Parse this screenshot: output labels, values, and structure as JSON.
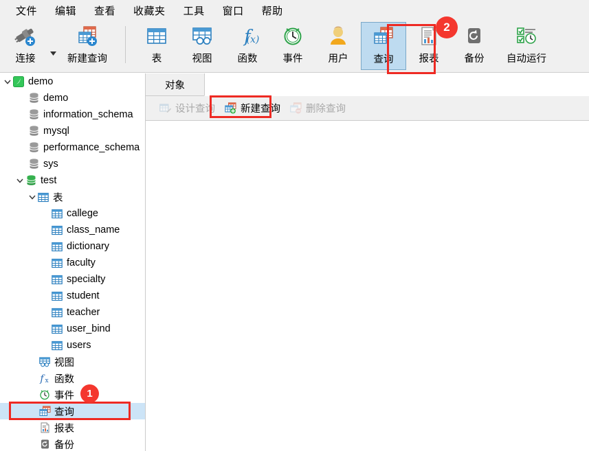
{
  "menubar": {
    "items": [
      {
        "label": "文件"
      },
      {
        "label": "编辑"
      },
      {
        "label": "查看"
      },
      {
        "label": "收藏夹"
      },
      {
        "label": "工具"
      },
      {
        "label": "窗口"
      },
      {
        "label": "帮助"
      }
    ]
  },
  "toolbar": {
    "items": [
      {
        "label": "连接",
        "icon": "plug-icon"
      },
      {
        "label": "新建查询",
        "icon": "new-query-icon"
      },
      {
        "label": "表",
        "icon": "table-icon"
      },
      {
        "label": "视图",
        "icon": "view-icon"
      },
      {
        "label": "函数",
        "icon": "function-icon"
      },
      {
        "label": "事件",
        "icon": "clock-icon"
      },
      {
        "label": "用户",
        "icon": "user-icon"
      },
      {
        "label": "查询",
        "icon": "query-icon"
      },
      {
        "label": "报表",
        "icon": "report-icon"
      },
      {
        "label": "备份",
        "icon": "backup-icon"
      },
      {
        "label": "自动运行",
        "icon": "automation-icon"
      }
    ]
  },
  "sidebar": {
    "tree": [
      {
        "label": "demo",
        "icon": "connection-icon",
        "indent": 0,
        "chevron": "expanded"
      },
      {
        "label": "demo",
        "icon": "database-icon",
        "indent": 1,
        "chevron": "none"
      },
      {
        "label": "information_schema",
        "icon": "database-icon",
        "indent": 1,
        "chevron": "none"
      },
      {
        "label": "mysql",
        "icon": "database-icon",
        "indent": 1,
        "chevron": "none"
      },
      {
        "label": "performance_schema",
        "icon": "database-icon",
        "indent": 1,
        "chevron": "none"
      },
      {
        "label": "sys",
        "icon": "database-icon",
        "indent": 1,
        "chevron": "none"
      },
      {
        "label": "test",
        "icon": "database-open-icon",
        "indent": 1,
        "chevron": "expanded"
      },
      {
        "label": "表",
        "icon": "table-folder-icon",
        "indent": 2,
        "chevron": "expanded"
      },
      {
        "label": "callege",
        "icon": "table-icon",
        "indent": 3,
        "chevron": "none"
      },
      {
        "label": "class_name",
        "icon": "table-icon",
        "indent": 3,
        "chevron": "none"
      },
      {
        "label": "dictionary",
        "icon": "table-icon",
        "indent": 3,
        "chevron": "none"
      },
      {
        "label": "faculty",
        "icon": "table-icon",
        "indent": 3,
        "chevron": "none"
      },
      {
        "label": "specialty",
        "icon": "table-icon",
        "indent": 3,
        "chevron": "none"
      },
      {
        "label": "student",
        "icon": "table-icon",
        "indent": 3,
        "chevron": "none"
      },
      {
        "label": "teacher",
        "icon": "table-icon",
        "indent": 3,
        "chevron": "none"
      },
      {
        "label": "user_bind",
        "icon": "table-icon",
        "indent": 3,
        "chevron": "none"
      },
      {
        "label": "users",
        "icon": "table-icon",
        "indent": 3,
        "chevron": "none"
      },
      {
        "label": "视图",
        "icon": "view-icon",
        "indent": 2,
        "chevron": "none"
      },
      {
        "label": "函数",
        "icon": "function-icon",
        "indent": 2,
        "chevron": "none"
      },
      {
        "label": "事件",
        "icon": "clock-icon",
        "indent": 2,
        "chevron": "none"
      },
      {
        "label": "查询",
        "icon": "query-icon",
        "indent": 2,
        "chevron": "none",
        "selected": true
      },
      {
        "label": "报表",
        "icon": "report-icon",
        "indent": 2,
        "chevron": "none"
      },
      {
        "label": "备份",
        "icon": "backup-icon",
        "indent": 2,
        "chevron": "none"
      }
    ]
  },
  "main": {
    "tab": "对象",
    "commands": [
      {
        "label": "设计查询",
        "icon": "design-query-icon",
        "enabled": false
      },
      {
        "label": "新建查询",
        "icon": "new-query-icon",
        "enabled": true
      },
      {
        "label": "删除查询",
        "icon": "delete-query-icon",
        "enabled": false
      }
    ]
  },
  "annotations": {
    "badge_one": "1",
    "badge_two": "2",
    "highlight_color": "#ee2a23"
  }
}
